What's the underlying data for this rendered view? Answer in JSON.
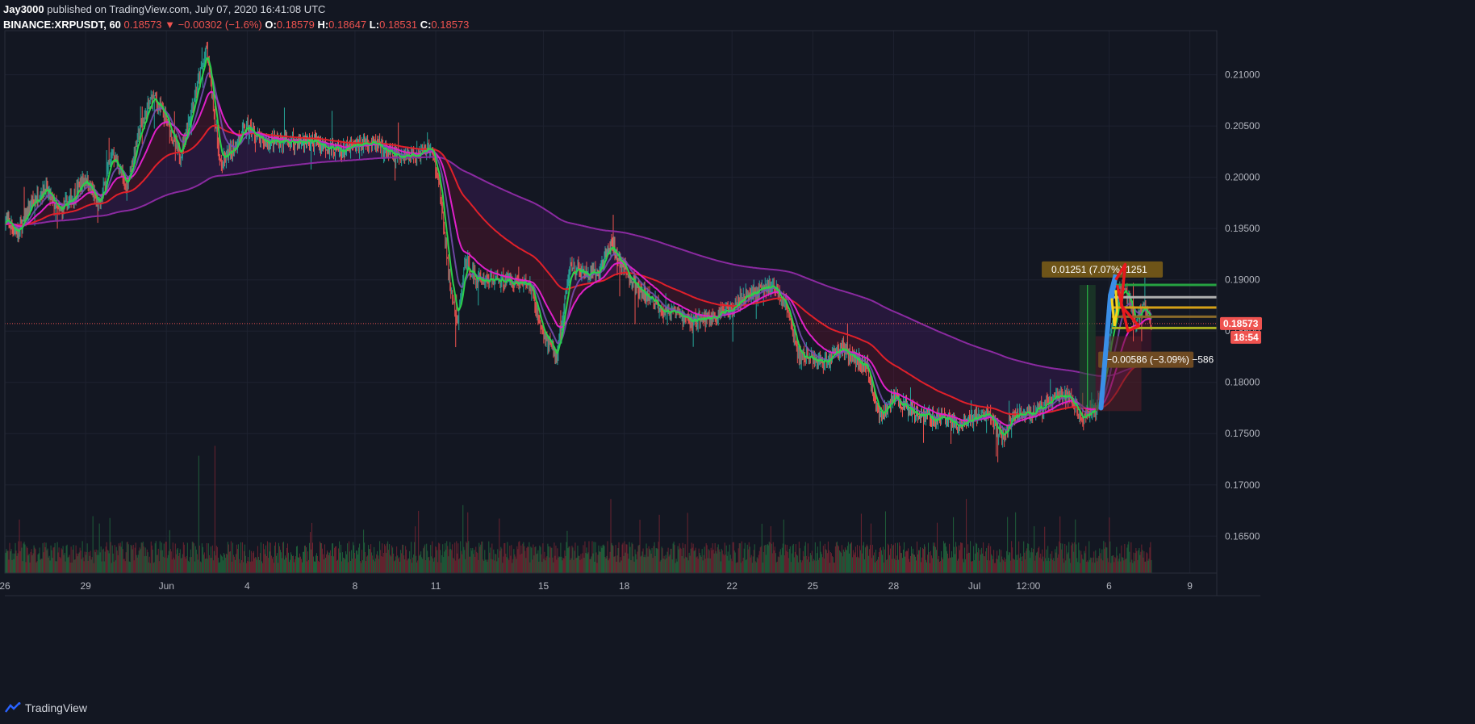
{
  "header": {
    "author": "Jay3000",
    "published_text": "published on TradingView.com, July 07, 2020 16:41:08 UTC",
    "symbol": "BINANCE:XRPUSDT, 60",
    "last": "0.18573",
    "arrow": "▼",
    "change": "−0.00302 (−1.6%)",
    "o_label": "O:",
    "o_value": "0.18579",
    "h_label": "H:",
    "h_value": "0.18647",
    "l_label": "L:",
    "l_value": "0.18531",
    "c_label": "C:",
    "c_value": "0.18573"
  },
  "footer": {
    "brand": "TradingView"
  },
  "colors": {
    "background": "#131722",
    "grid": "#1e2230",
    "up": "#26a69a",
    "down": "#ef5350",
    "ma_fast": "#2bd14a",
    "ma_mid": "#7b4fb5",
    "ma_pink": "#e020c8",
    "ma_red": "#e0202a",
    "ma_slow": "#8a2aa0",
    "price_line": "#ef5350"
  },
  "chart_data": {
    "type": "candlestick",
    "symbol": "BINANCE:XRPUSDT",
    "interval": "60",
    "y_axis": {
      "ticks": [
        "0.21000",
        "0.20500",
        "0.20000",
        "0.19500",
        "0.19000",
        "0.18500",
        "0.18000",
        "0.17500",
        "0.17000",
        "0.16500"
      ],
      "tick_values": [
        0.21,
        0.205,
        0.2,
        0.195,
        0.19,
        0.185,
        0.18,
        0.175,
        0.17,
        0.165
      ],
      "range": [
        0.1614,
        0.2143
      ]
    },
    "x_axis": {
      "ticks": [
        "26",
        "29",
        "Jun",
        "4",
        "8",
        "11",
        "15",
        "18",
        "22",
        "25",
        "28",
        "Jul",
        "12:00",
        "6",
        "9"
      ],
      "tick_positions": [
        0.5,
        3.5,
        6.5,
        9.5,
        13.5,
        16.5,
        20.5,
        23.5,
        27.5,
        30.5,
        33.5,
        36.5,
        38.5,
        41.5,
        44.5
      ],
      "range": [
        0.5,
        45.5
      ]
    },
    "last_price": 0.18573,
    "last_price_label": "0.18573",
    "countdown_label": "18:54",
    "price_path": [
      [
        0.5,
        0.196
      ],
      [
        1,
        0.1945
      ],
      [
        1.5,
        0.1975
      ],
      [
        2,
        0.199
      ],
      [
        2.5,
        0.1965
      ],
      [
        3,
        0.198
      ],
      [
        3.5,
        0.2
      ],
      [
        4,
        0.197
      ],
      [
        4.5,
        0.2025
      ],
      [
        5,
        0.199
      ],
      [
        5.5,
        0.2045
      ],
      [
        6,
        0.208
      ],
      [
        6.5,
        0.2055
      ],
      [
        7,
        0.202
      ],
      [
        7.5,
        0.2075
      ],
      [
        8,
        0.2125
      ],
      [
        8.5,
        0.201
      ],
      [
        9,
        0.203
      ],
      [
        9.5,
        0.205
      ],
      [
        10,
        0.2035
      ],
      [
        11,
        0.2035
      ],
      [
        12,
        0.2035
      ],
      [
        13,
        0.2025
      ],
      [
        14,
        0.2035
      ],
      [
        15,
        0.202
      ],
      [
        16,
        0.2025
      ],
      [
        16.3,
        0.203
      ],
      [
        16.6,
        0.2
      ],
      [
        17,
        0.19
      ],
      [
        17.3,
        0.1855
      ],
      [
        17.6,
        0.192
      ],
      [
        18,
        0.19
      ],
      [
        19,
        0.19
      ],
      [
        20,
        0.1895
      ],
      [
        20.5,
        0.1845
      ],
      [
        21,
        0.1825
      ],
      [
        21.5,
        0.1915
      ],
      [
        22,
        0.1905
      ],
      [
        22.5,
        0.1905
      ],
      [
        23,
        0.1935
      ],
      [
        23.5,
        0.191
      ],
      [
        24,
        0.189
      ],
      [
        25,
        0.187
      ],
      [
        26,
        0.186
      ],
      [
        27,
        0.1865
      ],
      [
        28,
        0.1885
      ],
      [
        29,
        0.1895
      ],
      [
        29.5,
        0.1875
      ],
      [
        30,
        0.1825
      ],
      [
        31,
        0.182
      ],
      [
        31.5,
        0.1835
      ],
      [
        32,
        0.1825
      ],
      [
        32.5,
        0.1815
      ],
      [
        33,
        0.1765
      ],
      [
        33.5,
        0.1785
      ],
      [
        34,
        0.1775
      ],
      [
        35,
        0.1765
      ],
      [
        35.5,
        0.1765
      ],
      [
        36,
        0.1755
      ],
      [
        36.5,
        0.1765
      ],
      [
        37,
        0.177
      ],
      [
        37.5,
        0.1745
      ],
      [
        38,
        0.177
      ],
      [
        38.5,
        0.177
      ],
      [
        39,
        0.1775
      ],
      [
        39.5,
        0.1785
      ],
      [
        40,
        0.1785
      ],
      [
        40.5,
        0.1765
      ],
      [
        41,
        0.1775
      ],
      [
        41.3,
        0.1805
      ],
      [
        41.6,
        0.1855
      ],
      [
        41.9,
        0.189
      ],
      [
        42.2,
        0.1885
      ],
      [
        42.5,
        0.1855
      ],
      [
        42.8,
        0.1875
      ],
      [
        43.1,
        0.1855
      ]
    ],
    "volume": {
      "max_spikes": [
        [
          7.7,
          0.95
        ],
        [
          8.3,
          0.78
        ],
        [
          17.5,
          0.55
        ],
        [
          23,
          0.6
        ],
        [
          33.2,
          0.5
        ],
        [
          36.2,
          0.6
        ],
        [
          41.5,
          0.45
        ]
      ]
    },
    "annotations": {
      "long_label": "0.01251 (7.07%) 1251",
      "short_label": "−0.00586 (−3.09%) −586"
    }
  }
}
